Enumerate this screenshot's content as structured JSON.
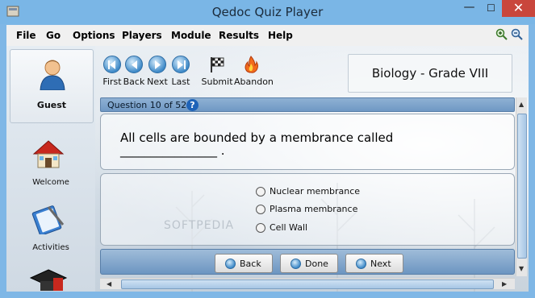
{
  "window": {
    "title": "Qedoc Quiz Player"
  },
  "menu": [
    "File",
    "Go",
    "Options",
    "Players",
    "Module",
    "Results",
    "Help"
  ],
  "sidebar": {
    "user": "Guest",
    "items": [
      {
        "label": "Welcome",
        "icon": "house-icon"
      },
      {
        "label": "Activities",
        "icon": "book-pen-icon"
      }
    ]
  },
  "toolbar": {
    "first": "First",
    "back": "Back",
    "next": "Next",
    "last": "Last",
    "submit": "Submit",
    "abandon": "Abandon"
  },
  "module": {
    "title": "Biology - Grade VIII"
  },
  "question": {
    "header": "Question 10 of 52.",
    "line1": "All cells are bounded by a membrance called",
    "line2": "________________ ."
  },
  "options": [
    "Nuclear membrance",
    "Plasma membrance",
    "Cell Wall"
  ],
  "nav": {
    "back": "Back",
    "done": "Done",
    "next": "Next"
  },
  "watermark": "SOFTPEDIA",
  "colors": {
    "titlebar": "#7ab6e6",
    "close": "#c9463c",
    "accent": "#3f8ac8"
  }
}
